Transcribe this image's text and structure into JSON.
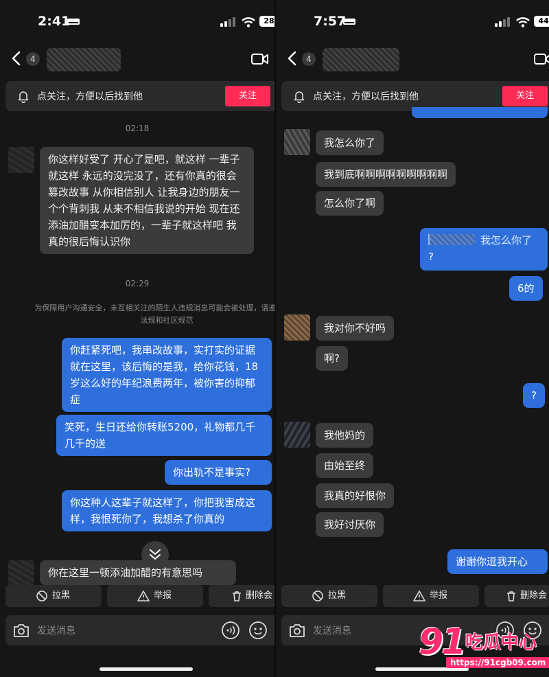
{
  "left": {
    "status": {
      "time": "2:41",
      "battery": "28"
    },
    "nav": {
      "unread": "4"
    },
    "follow": {
      "text": "点关注，方便以后找到他",
      "button": "关注"
    },
    "messages": [
      {
        "kind": "time",
        "text": "02:18"
      },
      {
        "kind": "in",
        "text": "你这样好受了 开心了是吧，就这样 一辈子就这样 永远的没完没了，还有你真的很会篡改故事 从你相信别人 让我身边的朋友一个个背刺我 从来不相信我说的开始 现在还添油加醋变本加厉的，一辈子就这样吧 我真的很后悔认识你"
      },
      {
        "kind": "time",
        "text": "02:29"
      },
      {
        "kind": "notice",
        "text": "为保障用户沟通安全，未互相关注的陌生人违规消息可能会被处理，请遵守法律法规和社区规范"
      },
      {
        "kind": "out",
        "text": "你赶紧死吧，我串改故事，实打实的证据就在这里，该后悔的是我，给你花钱，18岁这么好的年纪浪费两年，被你害的抑郁症"
      },
      {
        "kind": "out",
        "text": "笑死，生日还给你转账5200，礼物都几千几千的送"
      },
      {
        "kind": "out",
        "text": "你出轨不是事实?"
      },
      {
        "kind": "out",
        "text": "你这种人这辈子就这样了，你把我害成这样，我恨死你了，我想杀了你真的"
      },
      {
        "kind": "in",
        "text": "你在这里一顿添油加醋的有意思吗"
      }
    ],
    "actions": {
      "block": "拉黑",
      "report": "举报",
      "delete": "删除会"
    },
    "input": {
      "placeholder": "发送消息"
    }
  },
  "right": {
    "status": {
      "time": "7:57",
      "battery": "44"
    },
    "nav": {
      "unread": "4"
    },
    "follow": {
      "text": "点关注，方便以后找到他",
      "button": "关注"
    },
    "messages": [
      {
        "kind": "in",
        "text": "我怎么你了"
      },
      {
        "kind": "in",
        "text": "我到底啊啊啊啊啊啊啊啊啊"
      },
      {
        "kind": "in",
        "text": "怎么你了啊"
      },
      {
        "kind": "out-quote",
        "quote": "我怎么你了",
        "text": "?"
      },
      {
        "kind": "out",
        "text": "6的"
      },
      {
        "kind": "in",
        "text": "我对你不好吗"
      },
      {
        "kind": "in",
        "text": "啊?"
      },
      {
        "kind": "out",
        "text": "?"
      },
      {
        "kind": "in",
        "text": "我他妈的"
      },
      {
        "kind": "in",
        "text": "由始至终"
      },
      {
        "kind": "in",
        "text": "我真的好恨你"
      },
      {
        "kind": "in",
        "text": "我好讨厌你"
      },
      {
        "kind": "out",
        "text": "谢谢你逗我开心"
      }
    ],
    "actions": {
      "block": "拉黑",
      "report": "举报",
      "delete": "删除会"
    },
    "input": {
      "placeholder": "发送消息"
    }
  },
  "watermark": {
    "number": "91",
    "name": "吃瓜中心",
    "url": "https://91cgb09.com"
  },
  "colors": {
    "accent_red": "#fe2c55",
    "outgoing_blue": "#2e6fdc",
    "incoming_gray": "#3b3b3d",
    "background": "#161616"
  }
}
